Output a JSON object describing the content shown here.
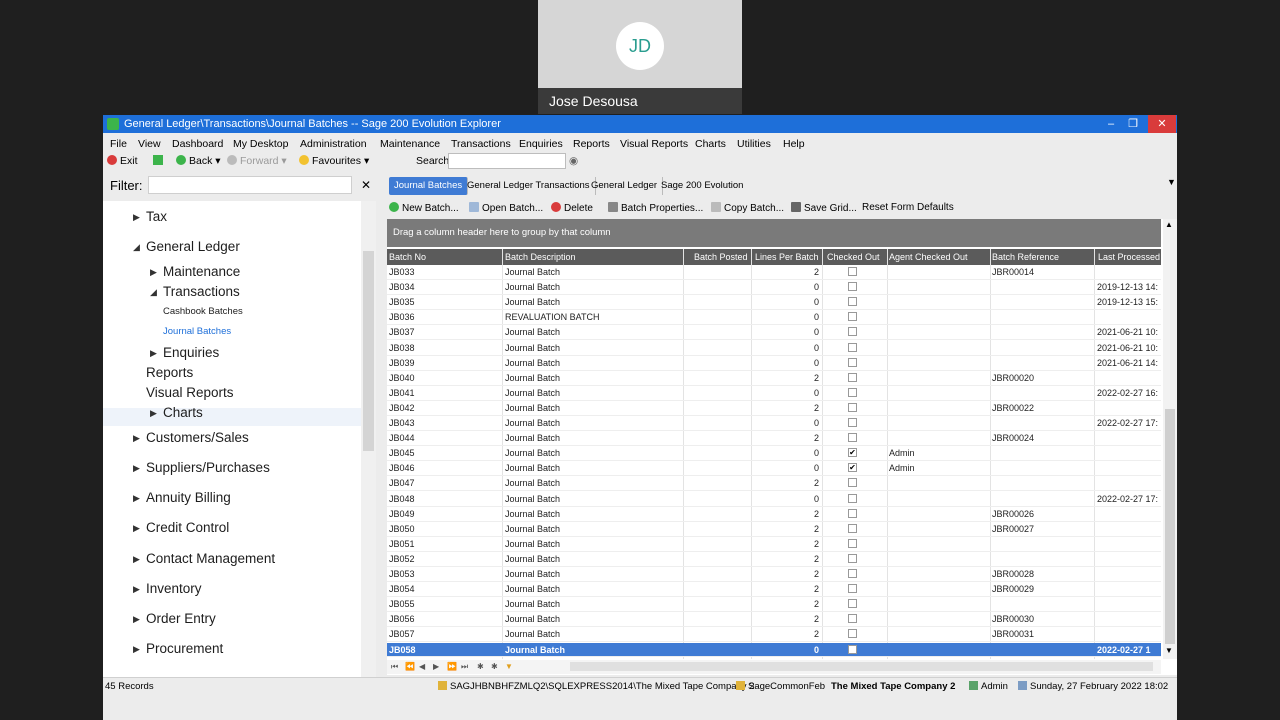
{
  "call": {
    "initials": "JD",
    "name": "Jose Desousa"
  },
  "window": {
    "title": "General Ledger\\Transactions\\Journal Batches -- Sage 200 Evolution Explorer"
  },
  "menu": [
    "File",
    "View",
    "Dashboard",
    "My Desktop",
    "Administration",
    "Maintenance",
    "Transactions",
    "Enquiries",
    "Reports",
    "Visual Reports",
    "Charts",
    "Utilities",
    "Help"
  ],
  "toolbar": {
    "exit": "Exit",
    "back": "Back",
    "forward": "Forward",
    "favourites": "Favourites",
    "search_label": "Search"
  },
  "filter": {
    "label": "Filter:",
    "value": ""
  },
  "nav": {
    "tax": "Tax",
    "general_ledger": "General Ledger",
    "maintenance": "Maintenance",
    "transactions": "Transactions",
    "cashbook_batches": "Cashbook Batches",
    "journal_batches": "Journal Batches",
    "enquiries": "Enquiries",
    "reports": "Reports",
    "visual_reports": "Visual Reports",
    "charts": "Charts",
    "customers_sales": "Customers/Sales",
    "suppliers_purchases": "Suppliers/Purchases",
    "annuity_billing": "Annuity Billing",
    "credit_control": "Credit Control",
    "contact_management": "Contact Management",
    "inventory": "Inventory",
    "order_entry": "Order Entry",
    "procurement": "Procurement"
  },
  "tabs": [
    "Journal Batches",
    "General Ledger Transactions",
    "General Ledger",
    "Sage 200 Evolution"
  ],
  "actions": {
    "new_batch": "New Batch...",
    "open_batch": "Open Batch...",
    "delete": "Delete",
    "batch_properties": "Batch Properties...",
    "copy_batch": "Copy Batch...",
    "save_grid": "Save Grid...",
    "reset_form": "Reset Form Defaults"
  },
  "grid": {
    "group_hint": "Drag a column header here to group by that column",
    "columns": {
      "batch_no": "Batch No",
      "batch_description": "Batch Description",
      "batch_posted": "Batch Posted",
      "lines_per_batch": "Lines Per Batch",
      "checked_out": "Checked Out",
      "agent_checked_out": "Agent Checked Out",
      "batch_reference": "Batch Reference",
      "last_processed": "Last Processed"
    },
    "rows": [
      {
        "no": "JB033",
        "desc": "Journal Batch",
        "lines": "2",
        "checked": false,
        "agent": "",
        "ref": "JBR00014",
        "last": ""
      },
      {
        "no": "JB034",
        "desc": "Journal Batch",
        "lines": "0",
        "checked": false,
        "agent": "",
        "ref": "",
        "last": "2019-12-13 14:"
      },
      {
        "no": "JB035",
        "desc": "Journal Batch",
        "lines": "0",
        "checked": false,
        "agent": "",
        "ref": "",
        "last": "2019-12-13 15:"
      },
      {
        "no": "JB036",
        "desc": "REVALUATION BATCH",
        "lines": "0",
        "checked": false,
        "agent": "",
        "ref": "",
        "last": ""
      },
      {
        "no": "JB037",
        "desc": "Journal Batch",
        "lines": "0",
        "checked": false,
        "agent": "",
        "ref": "",
        "last": "2021-06-21 10:"
      },
      {
        "no": "JB038",
        "desc": "Journal Batch",
        "lines": "0",
        "checked": false,
        "agent": "",
        "ref": "",
        "last": "2021-06-21 10:"
      },
      {
        "no": "JB039",
        "desc": "Journal Batch",
        "lines": "0",
        "checked": false,
        "agent": "",
        "ref": "",
        "last": "2021-06-21 14:"
      },
      {
        "no": "JB040",
        "desc": "Journal Batch",
        "lines": "2",
        "checked": false,
        "agent": "",
        "ref": "JBR00020",
        "last": ""
      },
      {
        "no": "JB041",
        "desc": "Journal Batch",
        "lines": "0",
        "checked": false,
        "agent": "",
        "ref": "",
        "last": "2022-02-27 16:"
      },
      {
        "no": "JB042",
        "desc": "Journal Batch",
        "lines": "2",
        "checked": false,
        "agent": "",
        "ref": "JBR00022",
        "last": ""
      },
      {
        "no": "JB043",
        "desc": "Journal Batch",
        "lines": "0",
        "checked": false,
        "agent": "",
        "ref": "",
        "last": "2022-02-27 17:"
      },
      {
        "no": "JB044",
        "desc": "Journal Batch",
        "lines": "2",
        "checked": false,
        "agent": "",
        "ref": "JBR00024",
        "last": ""
      },
      {
        "no": "JB045",
        "desc": "Journal Batch",
        "lines": "0",
        "checked": true,
        "agent": "Admin",
        "ref": "",
        "last": ""
      },
      {
        "no": "JB046",
        "desc": "Journal Batch",
        "lines": "0",
        "checked": true,
        "agent": "Admin",
        "ref": "",
        "last": ""
      },
      {
        "no": "JB047",
        "desc": "Journal Batch",
        "lines": "2",
        "checked": false,
        "agent": "",
        "ref": "",
        "last": ""
      },
      {
        "no": "JB048",
        "desc": "Journal Batch",
        "lines": "0",
        "checked": false,
        "agent": "",
        "ref": "",
        "last": "2022-02-27 17:"
      },
      {
        "no": "JB049",
        "desc": "Journal Batch",
        "lines": "2",
        "checked": false,
        "agent": "",
        "ref": "JBR00026",
        "last": ""
      },
      {
        "no": "JB050",
        "desc": "Journal Batch",
        "lines": "2",
        "checked": false,
        "agent": "",
        "ref": "JBR00027",
        "last": ""
      },
      {
        "no": "JB051",
        "desc": "Journal Batch",
        "lines": "2",
        "checked": false,
        "agent": "",
        "ref": "",
        "last": ""
      },
      {
        "no": "JB052",
        "desc": "Journal Batch",
        "lines": "2",
        "checked": false,
        "agent": "",
        "ref": "",
        "last": ""
      },
      {
        "no": "JB053",
        "desc": "Journal Batch",
        "lines": "2",
        "checked": false,
        "agent": "",
        "ref": "JBR00028",
        "last": ""
      },
      {
        "no": "JB054",
        "desc": "Journal Batch",
        "lines": "2",
        "checked": false,
        "agent": "",
        "ref": "JBR00029",
        "last": ""
      },
      {
        "no": "JB055",
        "desc": "Journal Batch",
        "lines": "2",
        "checked": false,
        "agent": "",
        "ref": "",
        "last": ""
      },
      {
        "no": "JB056",
        "desc": "Journal Batch",
        "lines": "2",
        "checked": false,
        "agent": "",
        "ref": "JBR00030",
        "last": ""
      },
      {
        "no": "JB057",
        "desc": "Journal Batch",
        "lines": "2",
        "checked": false,
        "agent": "",
        "ref": "JBR00031",
        "last": ""
      },
      {
        "no": "JB058",
        "desc": "Journal Batch",
        "lines": "0",
        "checked": false,
        "agent": "",
        "ref": "",
        "last": "2022-02-27 1",
        "selected": true
      }
    ]
  },
  "status": {
    "records": "45 Records",
    "server": "SAGJHBNBHFZMLQ2\\SQLEXPRESS2014\\The Mixed Tape Company 2",
    "common": "SageCommonFeb",
    "company": "The Mixed Tape Company 2",
    "user": "Admin",
    "datetime": "Sunday, 27 February 2022  18:02"
  }
}
